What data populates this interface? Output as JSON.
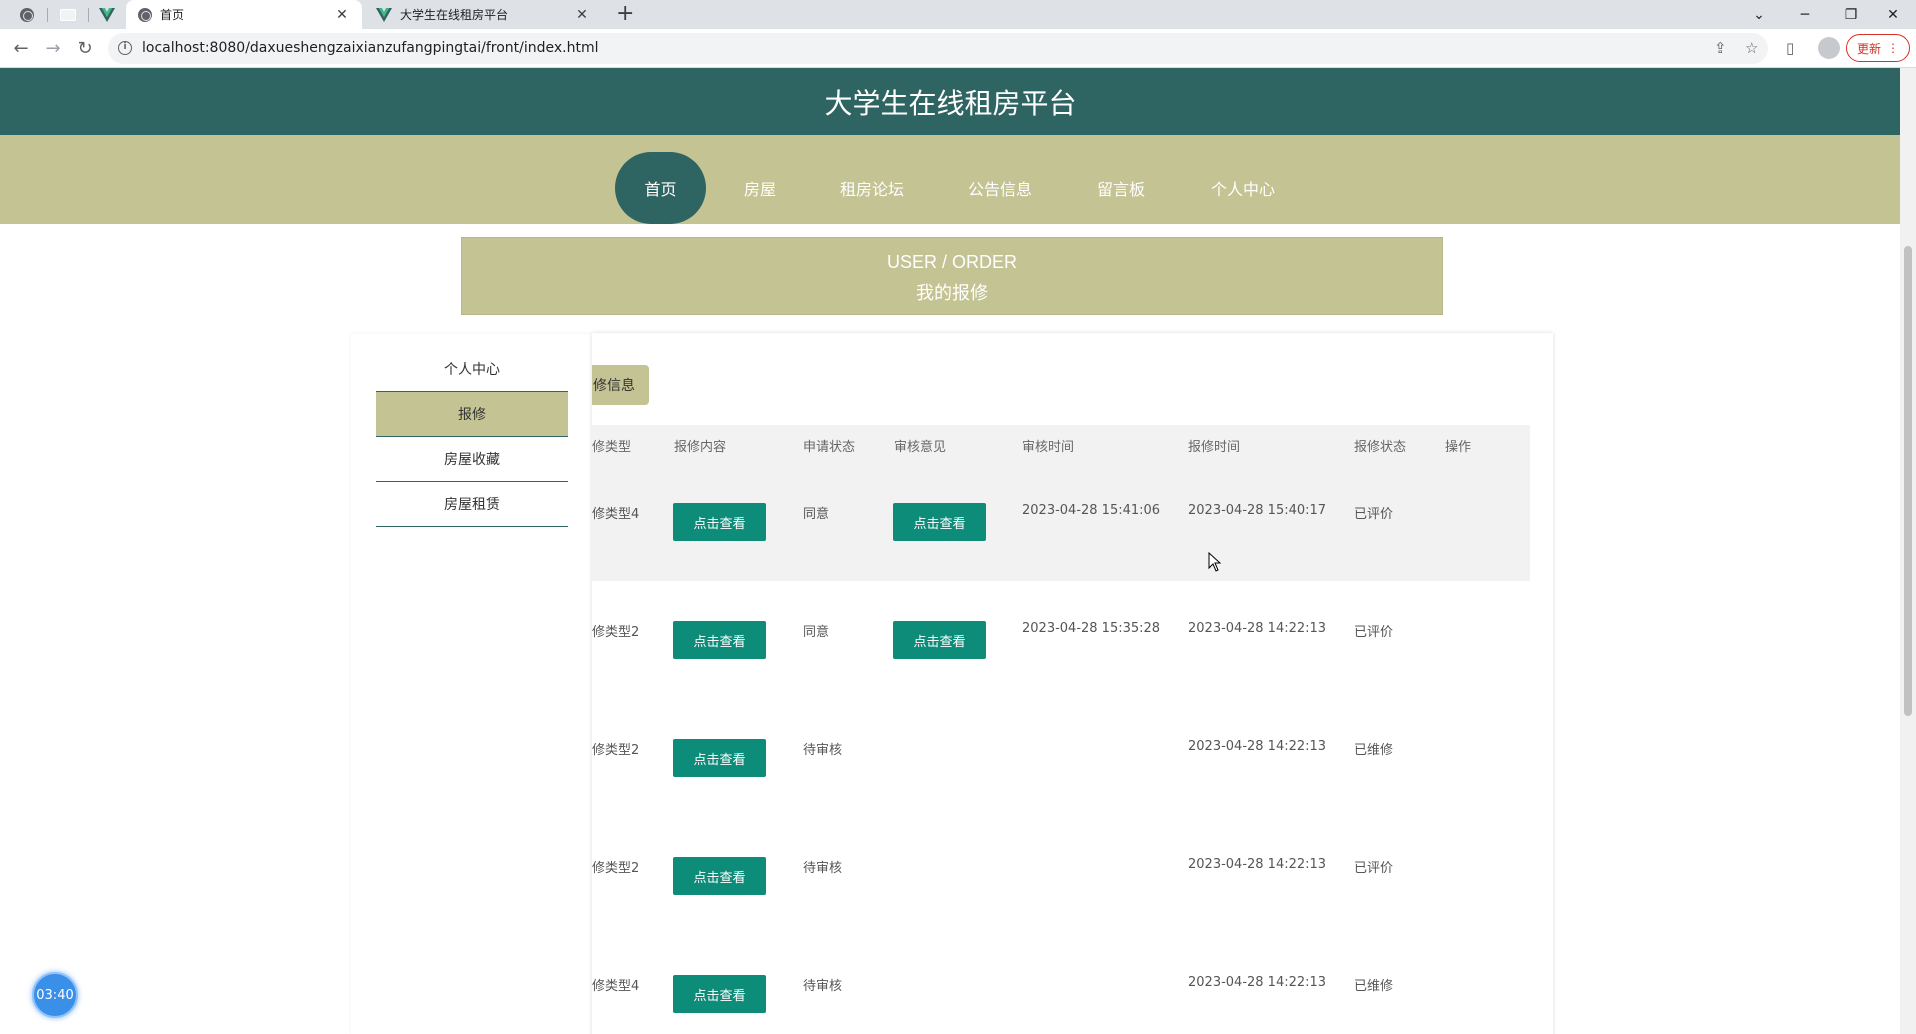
{
  "browser": {
    "tabs": [
      {
        "label": "首页",
        "active": true
      },
      {
        "label": "大学生在线租房平台",
        "active": false
      }
    ],
    "url": "localhost:8080/daxueshengzaixianzufangpingtai/front/index.html",
    "update_label": "更新"
  },
  "site": {
    "title": "大学生在线租房平台",
    "nav": [
      "首页",
      "房屋",
      "租房论坛",
      "公告信息",
      "留言板",
      "个人中心"
    ],
    "banner_en": "USER / ORDER",
    "banner_cn": "我的报修"
  },
  "sidebar": {
    "items": [
      "个人中心",
      "报修",
      "房屋收藏",
      "房屋租赁"
    ]
  },
  "content": {
    "tab_label": "修信息",
    "headers": [
      "修类型",
      "报修内容",
      "申请状态",
      "审核意见",
      "审核时间",
      "报修时间",
      "报修状态",
      "操作"
    ],
    "view_label": "点击查看",
    "rows": [
      {
        "type": "修类型4",
        "apply_status": "同意",
        "has_review": true,
        "review_time": "2023-04-28 15:41:06",
        "repair_time": "2023-04-28 15:40:17",
        "repair_status": "已评价"
      },
      {
        "type": "修类型2",
        "apply_status": "同意",
        "has_review": true,
        "review_time": "2023-04-28 15:35:28",
        "repair_time": "2023-04-28 14:22:13",
        "repair_status": "已评价"
      },
      {
        "type": "修类型2",
        "apply_status": "待审核",
        "has_review": false,
        "review_time": "",
        "repair_time": "2023-04-28 14:22:13",
        "repair_status": "已维修"
      },
      {
        "type": "修类型2",
        "apply_status": "待审核",
        "has_review": false,
        "review_time": "",
        "repair_time": "2023-04-28 14:22:13",
        "repair_status": "已评价"
      },
      {
        "type": "修类型4",
        "apply_status": "待审核",
        "has_review": false,
        "review_time": "",
        "repair_time": "2023-04-28 14:22:13",
        "repair_status": "已维修"
      }
    ]
  },
  "timer": "03:40",
  "colors": {
    "header": "#2e6461",
    "nav": "#c3c393",
    "button": "#0d8c7a"
  }
}
